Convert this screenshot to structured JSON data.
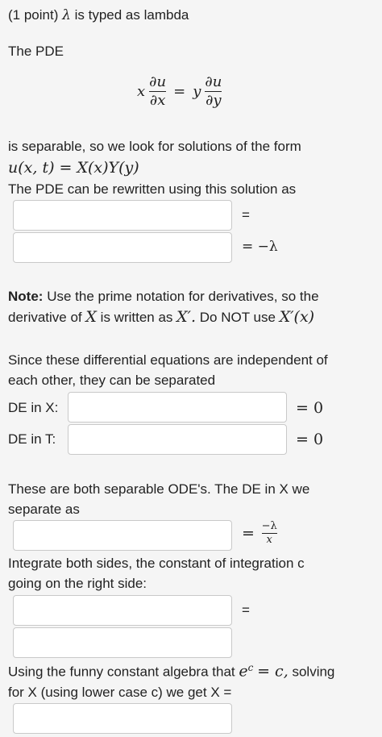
{
  "header": {
    "points": "(1 point)",
    "lambda_symbol": "λ",
    "note": "is typed as lambda"
  },
  "intro": "The PDE",
  "pde": {
    "lhs_coef": "x",
    "lhs_num": "∂u",
    "lhs_den": "∂x",
    "eq": "=",
    "rhs_coef": "y",
    "rhs_num": "∂u",
    "rhs_den": "∂y"
  },
  "separable_text": "is separable, so we look for solutions of the form",
  "solution_form": "u(x, t) = X(x)Y(y)",
  "rewrite_text": "The PDE can be rewritten using this solution as",
  "row1_rhs": "=",
  "row2_rhs": "= −λ",
  "note": {
    "label": "Note:",
    "line1": "Use the prime notation for derivatives, so the",
    "line2_a": "derivative of",
    "line2_X": "X",
    "line2_b": "is written as",
    "line2_Xp": "X′.",
    "line2_c": "Do NOT use",
    "line2_Xpx": "X′(x)"
  },
  "independent": {
    "line1": "Since these differential equations are independent of",
    "line2": "each other, they can be separated"
  },
  "de_x": {
    "label": "DE in X:",
    "rhs": "= 0"
  },
  "de_t": {
    "label": "DE in T:",
    "rhs": "= 0"
  },
  "separate": {
    "line1": "These are both separable ODE's. The DE in X we",
    "line2": "separate as",
    "rhs_eq": "=",
    "rhs_num": "−λ",
    "rhs_den": "x"
  },
  "integrate": {
    "line1": "Integrate both sides, the constant of integration c",
    "line2": "going on the right side:",
    "rhs": "="
  },
  "funny": {
    "line1_a": "Using the funny constant algebra that",
    "line1_e": "e",
    "line1_sup": "c",
    "line1_eq": "= c,",
    "line1_b": "solving",
    "line2": "for X (using lower case c) we get X ="
  }
}
